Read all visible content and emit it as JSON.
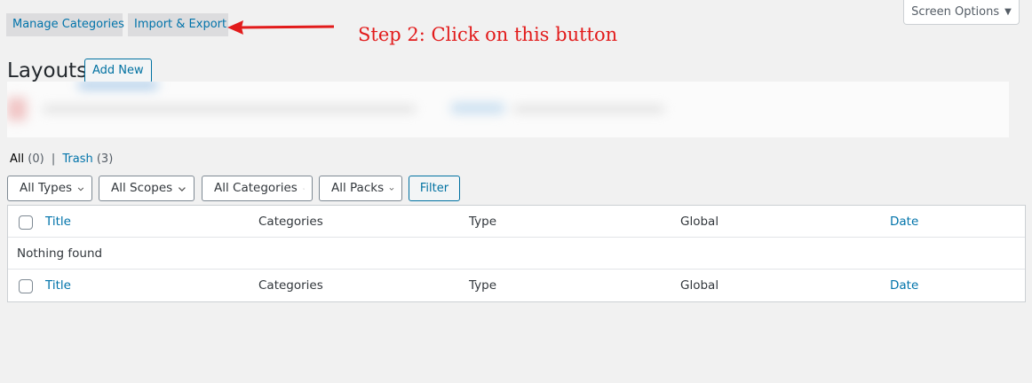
{
  "tabs": {
    "manage_categories": "Manage Categories",
    "import_export": "Import & Export"
  },
  "annotation": {
    "text": "Step 2: Click on this button",
    "color": "#e21b1b"
  },
  "screen_options": {
    "label": "Screen Options",
    "caret": "▼"
  },
  "page": {
    "title": "Layouts",
    "add_new": "Add New"
  },
  "views": {
    "all_label": "All",
    "all_count": "(0)",
    "separator": "|",
    "trash_label": "Trash",
    "trash_count": "(3)"
  },
  "filters": {
    "types": "All Types",
    "scopes": "All Scopes",
    "categories": "All Categories",
    "packs": "All Packs",
    "filter_button": "Filter"
  },
  "table": {
    "columns": {
      "title": "Title",
      "categories": "Categories",
      "type": "Type",
      "global": "Global",
      "date": "Date"
    },
    "empty_message": "Nothing found"
  },
  "colors": {
    "accent": "#0073aa",
    "background": "#f1f1f1",
    "arrow": "#e21b1b"
  }
}
